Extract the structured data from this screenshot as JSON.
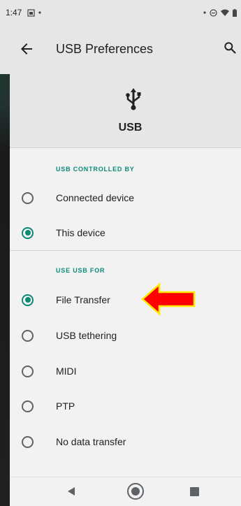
{
  "status_bar": {
    "time": "1:47",
    "left_icons": [
      "screenshot-icon",
      "dot-icon"
    ],
    "right_icons": [
      "dot-icon",
      "do-not-disturb-icon",
      "wifi-icon",
      "battery-icon"
    ]
  },
  "app_bar": {
    "title": "USB Preferences",
    "back_icon": "arrow-back-icon",
    "search_icon": "search-icon"
  },
  "header": {
    "icon": "usb-icon",
    "label": "USB"
  },
  "sections": [
    {
      "title": "USB CONTROLLED BY",
      "options": [
        {
          "label": "Connected device",
          "checked": false
        },
        {
          "label": "This device",
          "checked": true
        }
      ]
    },
    {
      "title": "USE USB FOR",
      "options": [
        {
          "label": "File Transfer",
          "checked": true
        },
        {
          "label": "USB tethering",
          "checked": false
        },
        {
          "label": "MIDI",
          "checked": false
        },
        {
          "label": "PTP",
          "checked": false
        },
        {
          "label": "No data transfer",
          "checked": false
        }
      ]
    }
  ],
  "annotation": {
    "icon": "red-arrow-icon",
    "fill": "#ff0000",
    "stroke": "#ffea00"
  },
  "colors": {
    "accent": "#0b8a78",
    "app_bar_bg": "#e6e6e6",
    "content_bg": "#f2f2f2"
  },
  "nav_bar": {
    "icons": [
      "nav-back-icon",
      "nav-home-icon",
      "nav-recents-icon"
    ]
  }
}
